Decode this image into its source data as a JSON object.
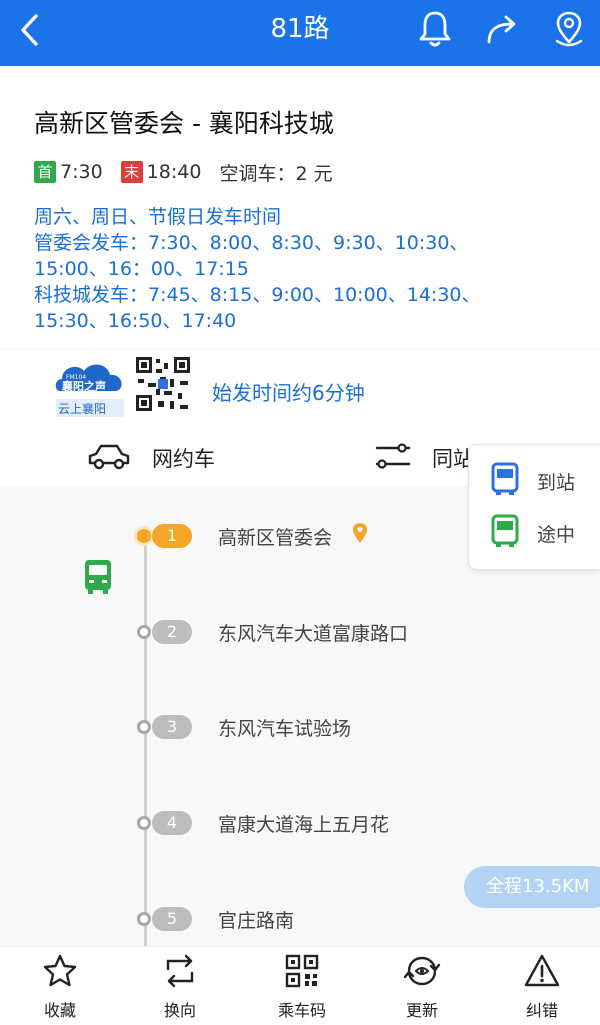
{
  "header": {
    "title": "81路",
    "back_icon": "back-arrow-icon",
    "bell_icon": "bell-icon",
    "share_icon": "share-icon",
    "location_icon": "location-pin-icon",
    "background": "#1a73e8"
  },
  "route": {
    "name": "高新区管委会 - 襄阳科技城",
    "first_tag": "首",
    "first_time": "7:30",
    "last_tag": "末",
    "last_time": "18:40",
    "fare": "空调车：2 元",
    "schedule_lines": [
      "周六、周日、节假日发车时间",
      "管委会发车：7:30、8:00、8:30、9:30、10:30、",
      "15:00、16：00、17:15",
      "科技城发车：7:45、8:15、9:00、10:00、14:30、",
      "15:30、16:50、17:40"
    ]
  },
  "promo": {
    "logo_top": "FM104",
    "logo_main": "襄阳之声",
    "logo_bottom": "云上襄阳",
    "text": "始发时间约6分钟"
  },
  "quick_actions": {
    "ride_hailing": {
      "label": "网约车",
      "icon": "car-icon"
    },
    "same_station": {
      "label": "同站线路",
      "icon": "route-lines-icon"
    }
  },
  "legend": {
    "arrived": "到站",
    "en_route": "途中",
    "arrived_color": "#2f6fe6",
    "en_route_color": "#2eaa4a"
  },
  "stops": [
    {
      "number": "1",
      "name": "高新区管委会"
    },
    {
      "number": "2",
      "name": "东风汽车大道富康路口"
    },
    {
      "number": "3",
      "name": "东风汽车试验场"
    },
    {
      "number": "4",
      "name": "富康大道海上五月花"
    },
    {
      "number": "5",
      "name": "官庄路南"
    }
  ],
  "distance": "全程13.5KM",
  "bottom_bar": [
    {
      "label": "收藏",
      "icon": "star-icon"
    },
    {
      "label": "换向",
      "icon": "swap-direction-icon"
    },
    {
      "label": "乘车码",
      "icon": "qr-code-icon"
    },
    {
      "label": "更新",
      "icon": "refresh-icon"
    },
    {
      "label": "纠错",
      "icon": "warning-icon"
    }
  ]
}
